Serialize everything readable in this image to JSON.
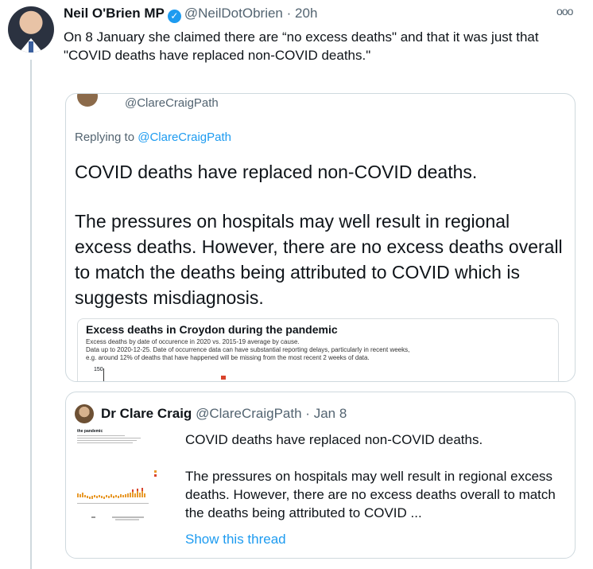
{
  "tweet": {
    "author_name": "Neil O'Brien MP",
    "handle": "@NeilDotObrien",
    "separator": "·",
    "time": "20h",
    "text": "On 8 January she claimed there are “no excess deaths\" and that it was just that \"COVID deaths have replaced non-COVID deaths.\""
  },
  "quoted_reply": {
    "handle": "@ClareCraigPath",
    "replying_prefix": "Replying to",
    "replying_to": "@ClareCraigPath",
    "paragraph1": "COVID deaths have replaced non-COVID deaths.",
    "paragraph2": "The pressures on hospitals may well result in regional excess deaths. However, there are no excess deaths overall to match the deaths being attributed to COVID which is suggests misdiagnosis.",
    "chart_preview": {
      "title": "Excess deaths in Croydon during the pandemic",
      "subtitle_lines": [
        "Excess deaths by date of occurence in 2020 vs. 2015-19 average by cause.",
        "Data up to 2020-12-25. Date of occurrence data can have substantial reporting delays, particularly in recent weeks,",
        "e.g. around 12% of deaths that have happened will be missing from the most recent 2 weeks of data."
      ],
      "y_tick": "150"
    }
  },
  "quoted_tweet": {
    "author_name": "Dr Clare Craig",
    "handle": "@ClareCraigPath",
    "separator": "·",
    "date": "Jan 8",
    "thumbnail_title": "the pandemic",
    "paragraph1": "COVID deaths have replaced non-COVID deaths.",
    "paragraph2": "The pressures on hospitals may well result in regional excess deaths. However, there are no excess deaths overall to match the deaths being attributed to COVID ...",
    "show_thread": "Show this thread"
  },
  "icons": {
    "verified": "verified-badge-icon",
    "more": "more-options-icon"
  },
  "colors": {
    "link": "#1d9bf0",
    "muted": "#536471",
    "border": "#cfd9de"
  }
}
